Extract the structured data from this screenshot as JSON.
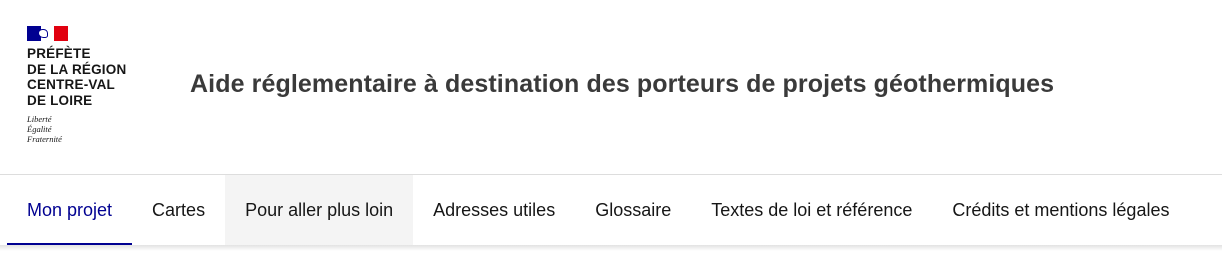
{
  "header": {
    "logo": {
      "name_lines": [
        "PRÉFÈTE",
        "DE LA RÉGION",
        "CENTRE-VAL",
        "DE LOIRE"
      ],
      "motto_lines": [
        "Liberté",
        "Égalité",
        "Fraternité"
      ]
    },
    "site_title": "Aide réglementaire à destination des porteurs de projets géothermiques"
  },
  "nav": {
    "items": [
      {
        "label": "Mon projet",
        "state": "active"
      },
      {
        "label": "Cartes",
        "state": "default"
      },
      {
        "label": "Pour aller plus loin",
        "state": "hover"
      },
      {
        "label": "Adresses utiles",
        "state": "default"
      },
      {
        "label": "Glossaire",
        "state": "default"
      },
      {
        "label": "Textes de loi et référence",
        "state": "default"
      },
      {
        "label": "Crédits et mentions légales",
        "state": "default"
      }
    ]
  },
  "colors": {
    "primary_blue": "#000091",
    "flag_red": "#e1000f",
    "text": "#161616",
    "title_text": "#3a3a3a",
    "hover_bg": "#f4f4f4"
  }
}
